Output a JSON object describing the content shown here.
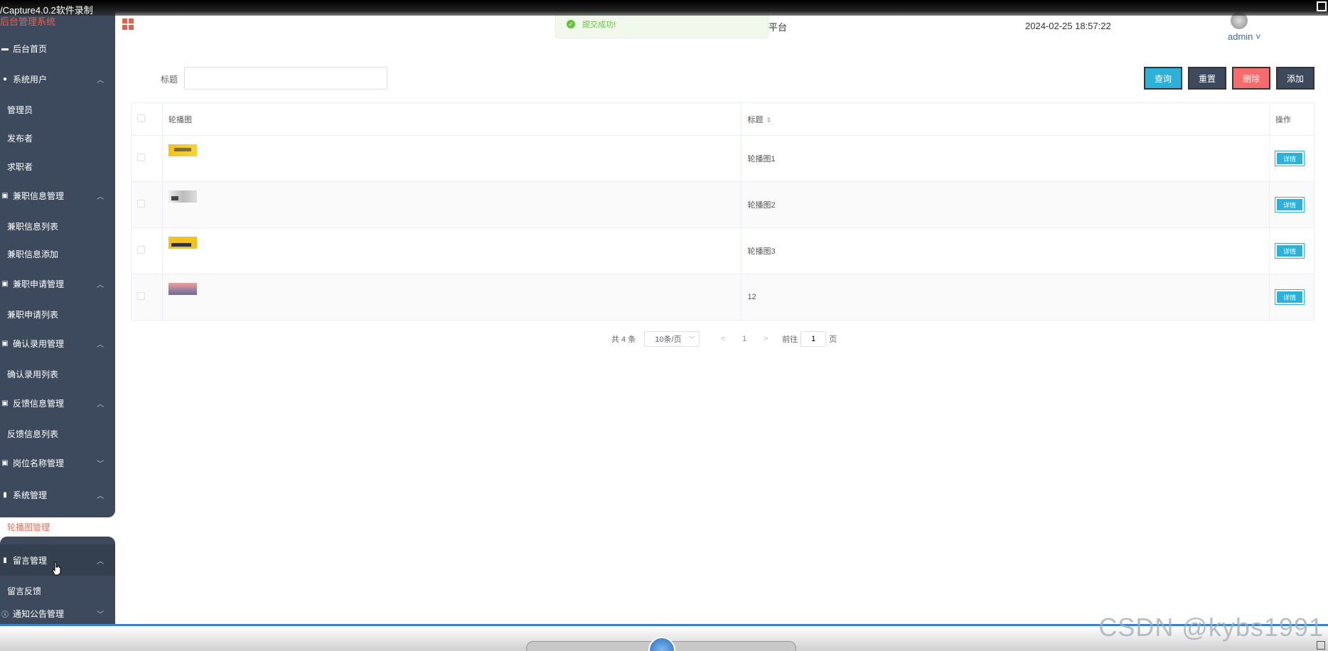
{
  "recorder": {
    "title": "/Capture4.0.2软件录制",
    "watermark": "CSDN @kybs1991"
  },
  "sidebar": {
    "brand": "后台管理系统",
    "menus": [
      {
        "label": "后台首页",
        "icon": "desktop-icon",
        "has_chevron": false
      },
      {
        "label": "系统用户",
        "icon": "user-icon",
        "chevron": "^"
      },
      {
        "label": "兼职信息管理",
        "icon": "chart-icon",
        "chevron": "^"
      },
      {
        "label": "兼职申请管理",
        "icon": "chart-icon",
        "chevron": "^"
      },
      {
        "label": "确认录用管理",
        "icon": "chart-icon",
        "chevron": "^"
      },
      {
        "label": "反馈信息管理",
        "icon": "chart-icon",
        "chevron": "^"
      },
      {
        "label": "岗位名称管理",
        "icon": "chart-icon",
        "chevron": "v"
      },
      {
        "label": "系统管理",
        "icon": "bar-chart-icon",
        "chevron": "^"
      },
      {
        "label": "留言管理",
        "icon": "bar-chart-icon",
        "chevron": "^"
      },
      {
        "label": "通知公告管理",
        "icon": "info-icon",
        "chevron": "v"
      }
    ],
    "subitems": {
      "users": [
        "管理员",
        "发布者",
        "求职者"
      ],
      "job_info": [
        "兼职信息列表",
        "兼职信息添加"
      ],
      "job_apply": [
        "兼职申请列表"
      ],
      "confirm_hire": [
        "确认录用列表"
      ],
      "feedback": [
        "反馈信息列表"
      ],
      "system": [
        "轮播图管理"
      ],
      "messages": [
        "留言反馈"
      ]
    }
  },
  "header": {
    "title_fragment": "平台",
    "datetime": "2024-02-25 18:57:22",
    "user": "admin ˅"
  },
  "toast": {
    "message": "提交成功!"
  },
  "search": {
    "label": "标题",
    "value": "",
    "placeholder": ""
  },
  "buttons": {
    "query": "查询",
    "reset": "重置",
    "delete": "删除",
    "add": "添加"
  },
  "table": {
    "headers": {
      "image": "轮播图",
      "title": "标题",
      "actions": "操作"
    },
    "rows": [
      {
        "title": "轮播图1",
        "action": "详情"
      },
      {
        "title": "轮播图2",
        "action": "详情"
      },
      {
        "title": "轮播图3",
        "action": "详情"
      },
      {
        "title": "12",
        "action": "详情"
      }
    ]
  },
  "pagination": {
    "total": "共 4 条",
    "page_size": "10条/页",
    "prev": "<",
    "current": "1",
    "next": ">",
    "goto_label": "前往",
    "goto_value": "1",
    "page_label": "页"
  },
  "colors": {
    "sidebar": "#3d4a5e",
    "accent": "#e0644d",
    "primary": "#2eb1d8",
    "danger": "#f56c6c"
  }
}
